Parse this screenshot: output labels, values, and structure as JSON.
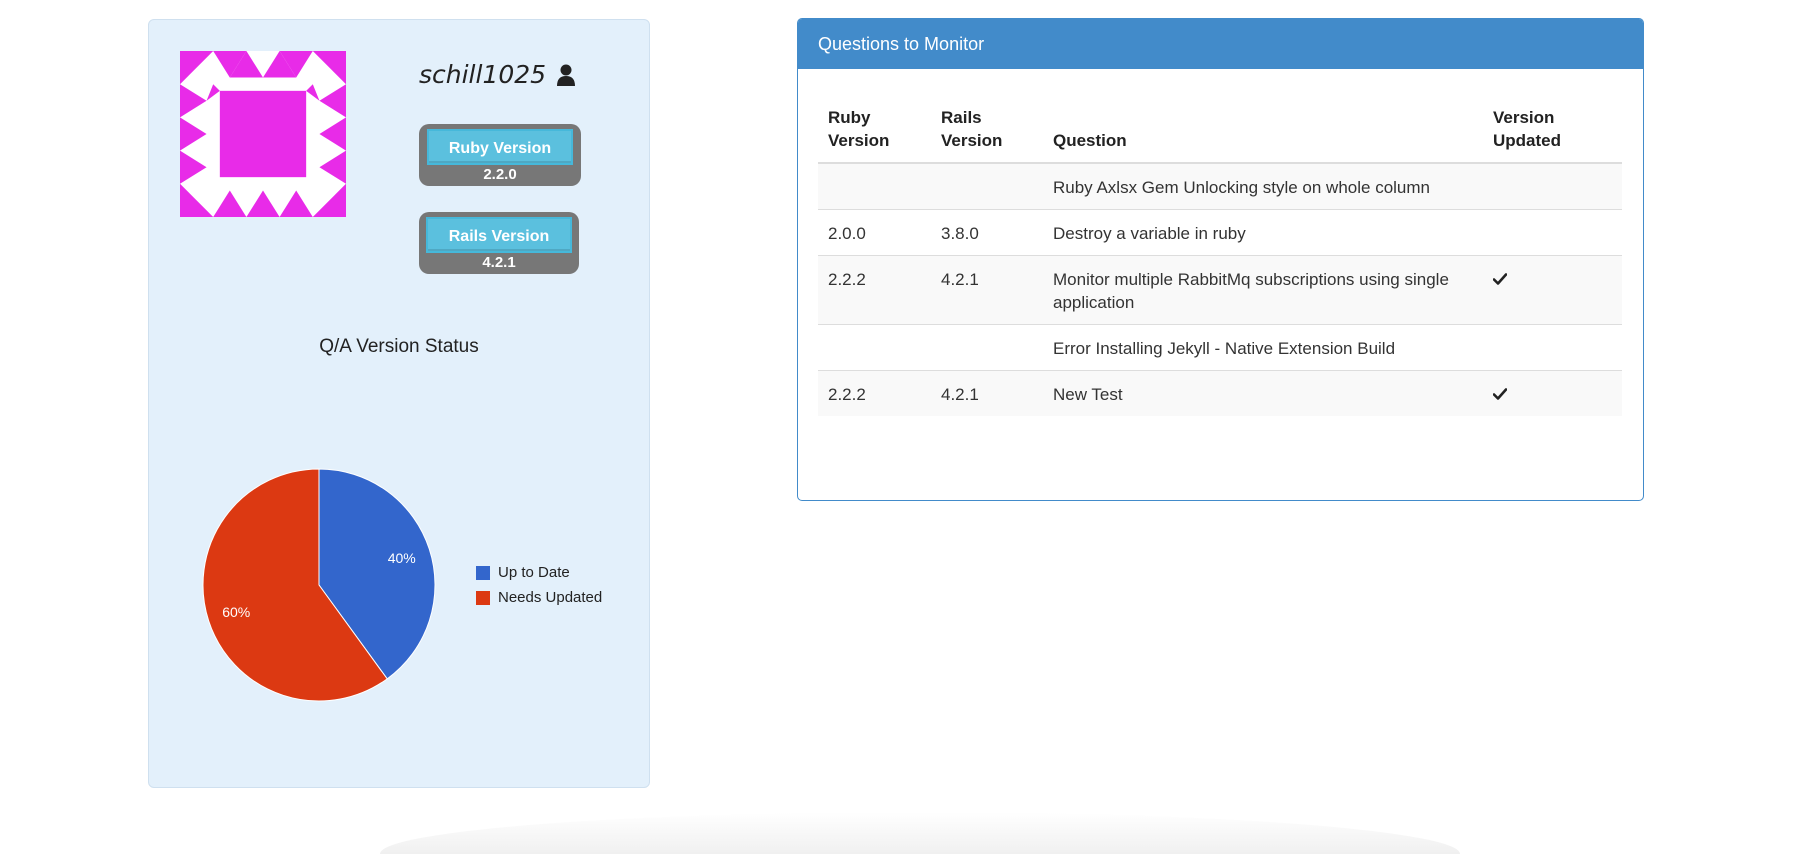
{
  "profile": {
    "username": "schill1025",
    "ruby": {
      "label": "Ruby Version",
      "value": "2.2.0"
    },
    "rails": {
      "label": "Rails Version",
      "value": "4.2.1"
    },
    "avatar_color": "#e82be8",
    "user_icon": "user-icon"
  },
  "chart_data": {
    "type": "pie",
    "title": "Q/A Version Status",
    "categories": [
      "Up to Date",
      "Needs Updated"
    ],
    "values": [
      40,
      60
    ],
    "labels": [
      "40%",
      "60%"
    ],
    "colors": [
      "#3366cc",
      "#dc3912"
    ],
    "legend": "right"
  },
  "questions": {
    "heading": "Questions to Monitor",
    "headers": {
      "ruby": [
        "Ruby",
        "Version"
      ],
      "rails": [
        "Rails",
        "Version"
      ],
      "question": "Question",
      "updated": [
        "Version",
        "Updated"
      ]
    },
    "rows": [
      {
        "ruby": "",
        "rails": "",
        "question": "Ruby Axlsx Gem Unlocking style on whole column",
        "updated": false
      },
      {
        "ruby": "2.0.0",
        "rails": "3.8.0",
        "question": "Destroy a variable in ruby",
        "updated": false
      },
      {
        "ruby": "2.2.2",
        "rails": "4.2.1",
        "question": "Monitor multiple RabbitMq subscriptions using single application",
        "updated": true
      },
      {
        "ruby": "",
        "rails": "",
        "question": "Error Installing Jekyll - Native Extension Build",
        "updated": false
      },
      {
        "ruby": "2.2.2",
        "rails": "4.2.1",
        "question": "New Test",
        "updated": true
      }
    ]
  }
}
